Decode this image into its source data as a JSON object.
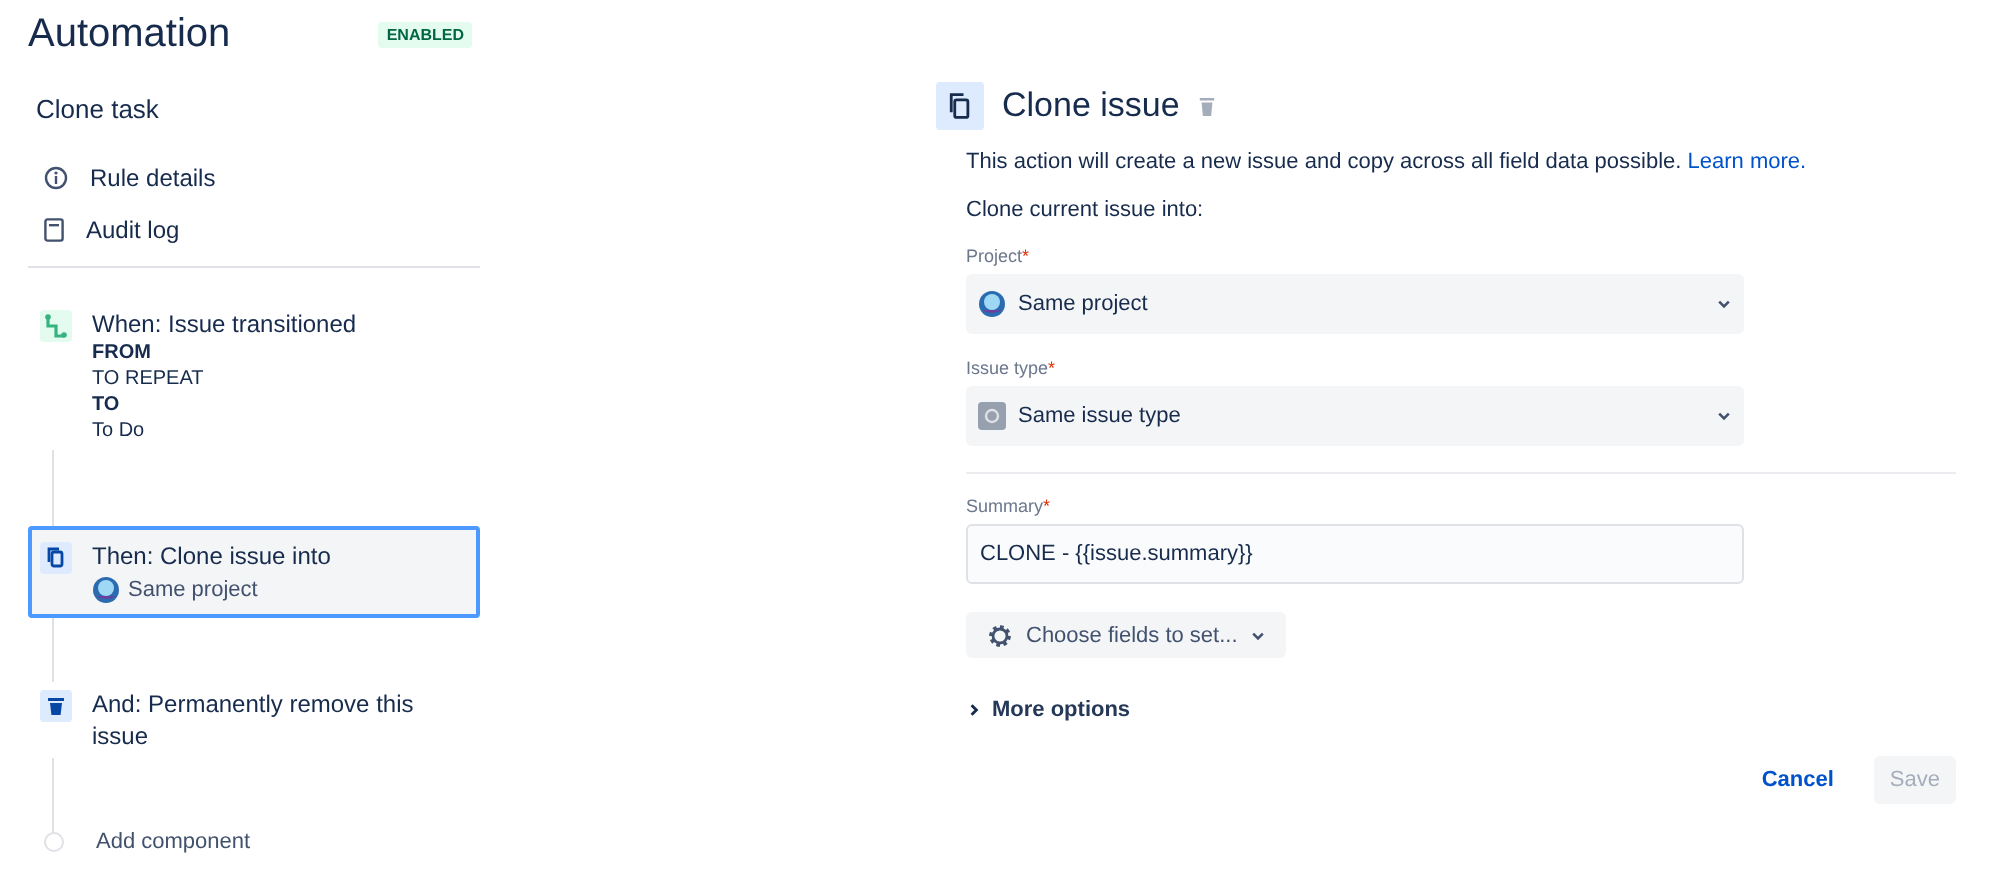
{
  "header": {
    "title": "Automation",
    "status_badge": "ENABLED"
  },
  "sidebar": {
    "rule_name": "Clone task",
    "links": [
      {
        "label": "Rule details",
        "kind": "info"
      },
      {
        "label": "Audit log",
        "kind": "log"
      }
    ],
    "components": [
      {
        "kind": "trigger",
        "title": "When: Issue transitioned",
        "details": [
          {
            "text": "FROM",
            "bold": true
          },
          {
            "text": "TO REPEAT",
            "bold": false
          },
          {
            "text": "TO",
            "bold": true
          },
          {
            "text": "To Do",
            "bold": false
          }
        ],
        "selected": false
      },
      {
        "kind": "action",
        "title": "Then: Clone issue into",
        "subtitle": "Same project",
        "selected": true
      },
      {
        "kind": "delete",
        "title": "And: Permanently remove this issue",
        "selected": false
      }
    ],
    "add_component": "Add component"
  },
  "editor": {
    "title": "Clone issue",
    "description": "This action will create a new issue and copy across all field data possible.",
    "link": "Learn more.",
    "intro": "Clone current issue into:",
    "fields": [
      {
        "kind": "select",
        "label": "Project",
        "required_mark": "*",
        "value": "Same project"
      },
      {
        "kind": "select",
        "label": "Issue type",
        "required_mark": "*",
        "value": "Same issue type"
      },
      {
        "kind": "text",
        "label": "Summary",
        "required_mark": "*",
        "value": "CLONE - {{issue.summary}}"
      }
    ],
    "choose_fields_button": "Choose fields to set...",
    "more_options": {
      "label": "More options",
      "expanded": false
    },
    "actions": [
      {
        "label": "Cancel",
        "kind": "link",
        "disabled": false
      },
      {
        "label": "Save",
        "kind": "primary",
        "disabled": true
      }
    ]
  }
}
